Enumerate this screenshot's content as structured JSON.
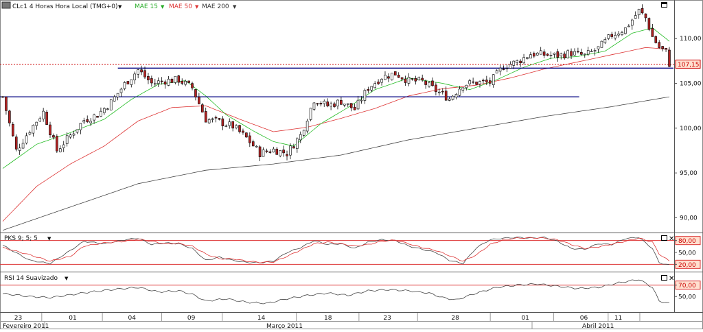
{
  "main_header": {
    "instrument": "CLc1 4 Horas Hora Local (TMG+0)",
    "mae15": "MAE 15",
    "mae50": "MAE 50",
    "mae200": "MAE 200"
  },
  "pks_header": {
    "label": "PKS 9; 5; 5"
  },
  "rsi_header": {
    "label": "RSI 14 Suavizado"
  },
  "colors": {
    "candle_up": "#ffffff",
    "candle_down": "#b22222",
    "mae15": "#22bb22",
    "mae50": "#dd3333",
    "mae200": "#444444",
    "resistance": "#000080",
    "last_price": "#cc0000",
    "last_price_box": "#ffe0d0"
  },
  "x_axis": {
    "day_labels": [
      "23",
      "01",
      "04",
      "09",
      "14",
      "18",
      "23",
      "28",
      "01",
      "06",
      "11"
    ],
    "month_labels": [
      "Fevereiro 2011",
      "Março 2011",
      "Abril 2011"
    ]
  },
  "chart_data": [
    {
      "type": "candlestick",
      "panel": "price",
      "ylim": [
        88.5,
        114
      ],
      "y_ticks": [
        "110,00",
        "105,00",
        "100,00",
        "95,00",
        "90,00"
      ],
      "last_price_label": "107,15",
      "last_price": 107.15,
      "horizontal_lines": [
        {
          "name": "upper",
          "y": 106.7,
          "x_start_frac": 0.175,
          "x_end_frac": 1.0
        },
        {
          "name": "lower",
          "y": 103.5,
          "x_start_frac": 0.0,
          "x_end_frac": 0.86
        }
      ],
      "close_anchors": [
        [
          0,
          103.5
        ],
        [
          4,
          97.5
        ],
        [
          8,
          99.8
        ],
        [
          12,
          101.8
        ],
        [
          16,
          97.5
        ],
        [
          20,
          99.2
        ],
        [
          24,
          100.9
        ],
        [
          28,
          101.5
        ],
        [
          32,
          102.9
        ],
        [
          36,
          104.9
        ],
        [
          40,
          106.5
        ],
        [
          44,
          105.0
        ],
        [
          48,
          105.3
        ],
        [
          52,
          105.4
        ],
        [
          56,
          104.5
        ],
        [
          60,
          101.0
        ],
        [
          64,
          100.7
        ],
        [
          68,
          100.2
        ],
        [
          72,
          98.9
        ],
        [
          76,
          97.2
        ],
        [
          80,
          97.6
        ],
        [
          84,
          97.2
        ],
        [
          88,
          99.2
        ],
        [
          92,
          103.2
        ],
        [
          96,
          102.5
        ],
        [
          100,
          103.0
        ],
        [
          104,
          102.1
        ],
        [
          108,
          104.5
        ],
        [
          112,
          105.7
        ],
        [
          116,
          106.1
        ],
        [
          120,
          105.3
        ],
        [
          124,
          105.2
        ],
        [
          128,
          104.2
        ],
        [
          132,
          103.3
        ],
        [
          136,
          104.9
        ],
        [
          140,
          105.1
        ],
        [
          144,
          105.1
        ],
        [
          148,
          106.9
        ],
        [
          152,
          107.4
        ],
        [
          156,
          108.3
        ],
        [
          160,
          108.2
        ],
        [
          164,
          108.1
        ],
        [
          168,
          108.4
        ],
        [
          172,
          108.1
        ],
        [
          176,
          108.9
        ],
        [
          180,
          110.4
        ],
        [
          184,
          111.1
        ],
        [
          188,
          113.1
        ],
        [
          190,
          112.3
        ],
        [
          192,
          110.2
        ],
        [
          194,
          109.0
        ],
        [
          196,
          108.5
        ],
        [
          197,
          107.2
        ]
      ],
      "mae15": [
        [
          0,
          95.5
        ],
        [
          10,
          98.2
        ],
        [
          20,
          99.5
        ],
        [
          30,
          101.0
        ],
        [
          38,
          103.2
        ],
        [
          46,
          104.9
        ],
        [
          54,
          105.3
        ],
        [
          60,
          103.6
        ],
        [
          66,
          101.5
        ],
        [
          74,
          99.7
        ],
        [
          80,
          98.5
        ],
        [
          86,
          98.0
        ],
        [
          94,
          100.5
        ],
        [
          102,
          102.3
        ],
        [
          110,
          104.3
        ],
        [
          120,
          105.6
        ],
        [
          130,
          105.0
        ],
        [
          138,
          104.3
        ],
        [
          146,
          105.4
        ],
        [
          154,
          106.8
        ],
        [
          162,
          107.8
        ],
        [
          170,
          108.0
        ],
        [
          178,
          108.6
        ],
        [
          186,
          110.6
        ],
        [
          192,
          111.2
        ],
        [
          197,
          109.7
        ]
      ],
      "mae50": [
        [
          0,
          89.6
        ],
        [
          10,
          93.5
        ],
        [
          20,
          96.0
        ],
        [
          30,
          98.0
        ],
        [
          40,
          100.8
        ],
        [
          50,
          102.3
        ],
        [
          60,
          102.5
        ],
        [
          70,
          101.0
        ],
        [
          80,
          99.6
        ],
        [
          90,
          100.1
        ],
        [
          100,
          101.1
        ],
        [
          110,
          102.2
        ],
        [
          120,
          103.6
        ],
        [
          130,
          104.4
        ],
        [
          140,
          104.8
        ],
        [
          150,
          105.6
        ],
        [
          160,
          106.6
        ],
        [
          170,
          107.4
        ],
        [
          180,
          108.2
        ],
        [
          190,
          109.0
        ],
        [
          197,
          108.8
        ]
      ],
      "mae200": [
        [
          0,
          88.6
        ],
        [
          20,
          91.2
        ],
        [
          40,
          93.8
        ],
        [
          60,
          95.3
        ],
        [
          80,
          96.0
        ],
        [
          100,
          97.0
        ],
        [
          120,
          98.7
        ],
        [
          140,
          100.0
        ],
        [
          160,
          101.3
        ],
        [
          180,
          102.4
        ],
        [
          197,
          103.5
        ]
      ],
      "n_bars": 198
    },
    {
      "type": "line",
      "panel": "pks",
      "ylim": [
        5,
        95
      ],
      "y_ticks": [
        "80,00",
        "50,00",
        "20,00"
      ],
      "levels": [
        80,
        20
      ],
      "series": [
        {
          "color": "#444444",
          "points": [
            [
              0,
              68
            ],
            [
              8,
              30
            ],
            [
              14,
              22
            ],
            [
              20,
              55
            ],
            [
              24,
              78
            ],
            [
              30,
              72
            ],
            [
              36,
              82
            ],
            [
              40,
              86
            ],
            [
              44,
              70
            ],
            [
              48,
              74
            ],
            [
              52,
              72
            ],
            [
              56,
              60
            ],
            [
              60,
              30
            ],
            [
              64,
              38
            ],
            [
              68,
              30
            ],
            [
              72,
              25
            ],
            [
              76,
              24
            ],
            [
              80,
              28
            ],
            [
              84,
              50
            ],
            [
              88,
              62
            ],
            [
              92,
              80
            ],
            [
              96,
              70
            ],
            [
              100,
              72
            ],
            [
              104,
              60
            ],
            [
              108,
              76
            ],
            [
              112,
              82
            ],
            [
              116,
              80
            ],
            [
              120,
              66
            ],
            [
              124,
              58
            ],
            [
              128,
              50
            ],
            [
              132,
              30
            ],
            [
              136,
              22
            ],
            [
              140,
              62
            ],
            [
              144,
              82
            ],
            [
              148,
              86
            ],
            [
              152,
              88
            ],
            [
              156,
              86
            ],
            [
              160,
              88
            ],
            [
              164,
              78
            ],
            [
              168,
              60
            ],
            [
              172,
              58
            ],
            [
              176,
              72
            ],
            [
              180,
              70
            ],
            [
              184,
              85
            ],
            [
              188,
              88
            ],
            [
              192,
              60
            ],
            [
              194,
              24
            ],
            [
              197,
              18
            ]
          ]
        },
        {
          "color": "#dd3333",
          "points": [
            [
              0,
              62
            ],
            [
              8,
              44
            ],
            [
              14,
              28
            ],
            [
              20,
              40
            ],
            [
              24,
              66
            ],
            [
              30,
              74
            ],
            [
              36,
              78
            ],
            [
              40,
              84
            ],
            [
              44,
              78
            ],
            [
              48,
              72
            ],
            [
              52,
              73
            ],
            [
              56,
              66
            ],
            [
              60,
              46
            ],
            [
              64,
              34
            ],
            [
              68,
              34
            ],
            [
              72,
              28
            ],
            [
              76,
              25
            ],
            [
              80,
              26
            ],
            [
              84,
              40
            ],
            [
              88,
              56
            ],
            [
              92,
              72
            ],
            [
              96,
              76
            ],
            [
              100,
              72
            ],
            [
              104,
              66
            ],
            [
              108,
              70
            ],
            [
              112,
              78
            ],
            [
              116,
              81
            ],
            [
              120,
              72
            ],
            [
              124,
              62
            ],
            [
              128,
              55
            ],
            [
              132,
              42
            ],
            [
              136,
              28
            ],
            [
              140,
              44
            ],
            [
              144,
              70
            ],
            [
              148,
              82
            ],
            [
              152,
              86
            ],
            [
              156,
              87
            ],
            [
              160,
              86
            ],
            [
              164,
              82
            ],
            [
              168,
              70
            ],
            [
              172,
              60
            ],
            [
              176,
              64
            ],
            [
              180,
              71
            ],
            [
              184,
              78
            ],
            [
              188,
              86
            ],
            [
              192,
              76
            ],
            [
              194,
              46
            ],
            [
              197,
              28
            ]
          ]
        }
      ]
    },
    {
      "type": "line",
      "panel": "rsi",
      "ylim": [
        25,
        90
      ],
      "y_ticks": [
        "70,00",
        "50,00"
      ],
      "levels": [
        70
      ],
      "series": [
        {
          "color": "#444444",
          "points": [
            [
              0,
              55
            ],
            [
              8,
              50
            ],
            [
              14,
              48
            ],
            [
              20,
              53
            ],
            [
              26,
              58
            ],
            [
              34,
              63
            ],
            [
              40,
              66
            ],
            [
              46,
              58
            ],
            [
              52,
              60
            ],
            [
              56,
              54
            ],
            [
              60,
              42
            ],
            [
              66,
              46
            ],
            [
              72,
              40
            ],
            [
              78,
              38
            ],
            [
              84,
              46
            ],
            [
              90,
              52
            ],
            [
              96,
              56
            ],
            [
              102,
              52
            ],
            [
              108,
              60
            ],
            [
              114,
              62
            ],
            [
              120,
              60
            ],
            [
              126,
              56
            ],
            [
              130,
              48
            ],
            [
              134,
              44
            ],
            [
              140,
              56
            ],
            [
              146,
              66
            ],
            [
              152,
              70
            ],
            [
              158,
              72
            ],
            [
              164,
              68
            ],
            [
              170,
              64
            ],
            [
              176,
              66
            ],
            [
              182,
              74
            ],
            [
              188,
              80
            ],
            [
              192,
              66
            ],
            [
              194,
              42
            ],
            [
              197,
              38
            ]
          ]
        }
      ]
    }
  ]
}
